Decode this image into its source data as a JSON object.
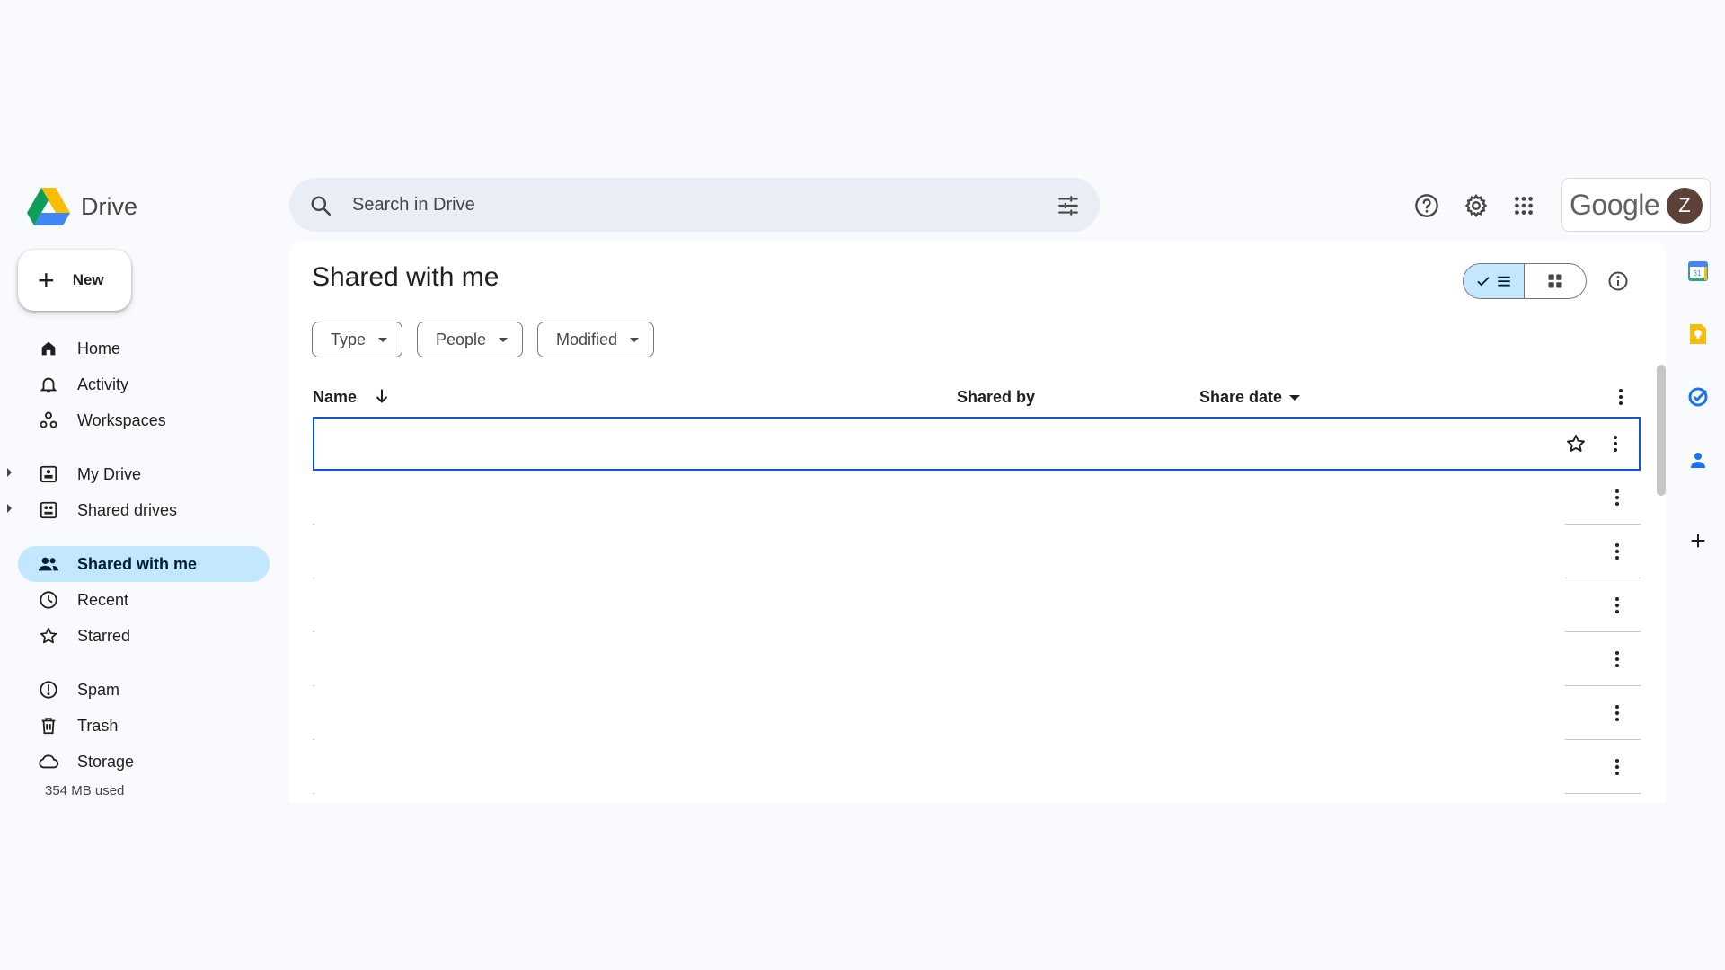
{
  "header": {
    "app_name": "Drive",
    "search_placeholder": "Search in Drive",
    "google_word": "Google",
    "avatar_initial": "Z"
  },
  "sidebar": {
    "new_label": "New",
    "items": [
      {
        "label": "Home",
        "icon": "home-icon"
      },
      {
        "label": "Activity",
        "icon": "bell-icon"
      },
      {
        "label": "Workspaces",
        "icon": "workspaces-icon"
      },
      {
        "label": "My Drive",
        "icon": "my-drive-icon"
      },
      {
        "label": "Shared drives",
        "icon": "shared-drives-icon"
      },
      {
        "label": "Shared with me",
        "icon": "people-icon",
        "active": true
      },
      {
        "label": "Recent",
        "icon": "clock-icon"
      },
      {
        "label": "Starred",
        "icon": "star-icon"
      },
      {
        "label": "Spam",
        "icon": "spam-icon"
      },
      {
        "label": "Trash",
        "icon": "trash-icon"
      },
      {
        "label": "Storage",
        "icon": "cloud-icon"
      }
    ],
    "storage_used": "354 MB used"
  },
  "main": {
    "title": "Shared with me",
    "filters": [
      {
        "label": "Type"
      },
      {
        "label": "People"
      },
      {
        "label": "Modified"
      }
    ],
    "columns": {
      "name": "Name",
      "shared_by": "Shared by",
      "share_date": "Share date"
    }
  },
  "colors": {
    "accent": "#0b57d0",
    "active_nav": "#c2e7ff",
    "search_bg": "#e9eef6",
    "page_bg": "#f8fafd"
  }
}
